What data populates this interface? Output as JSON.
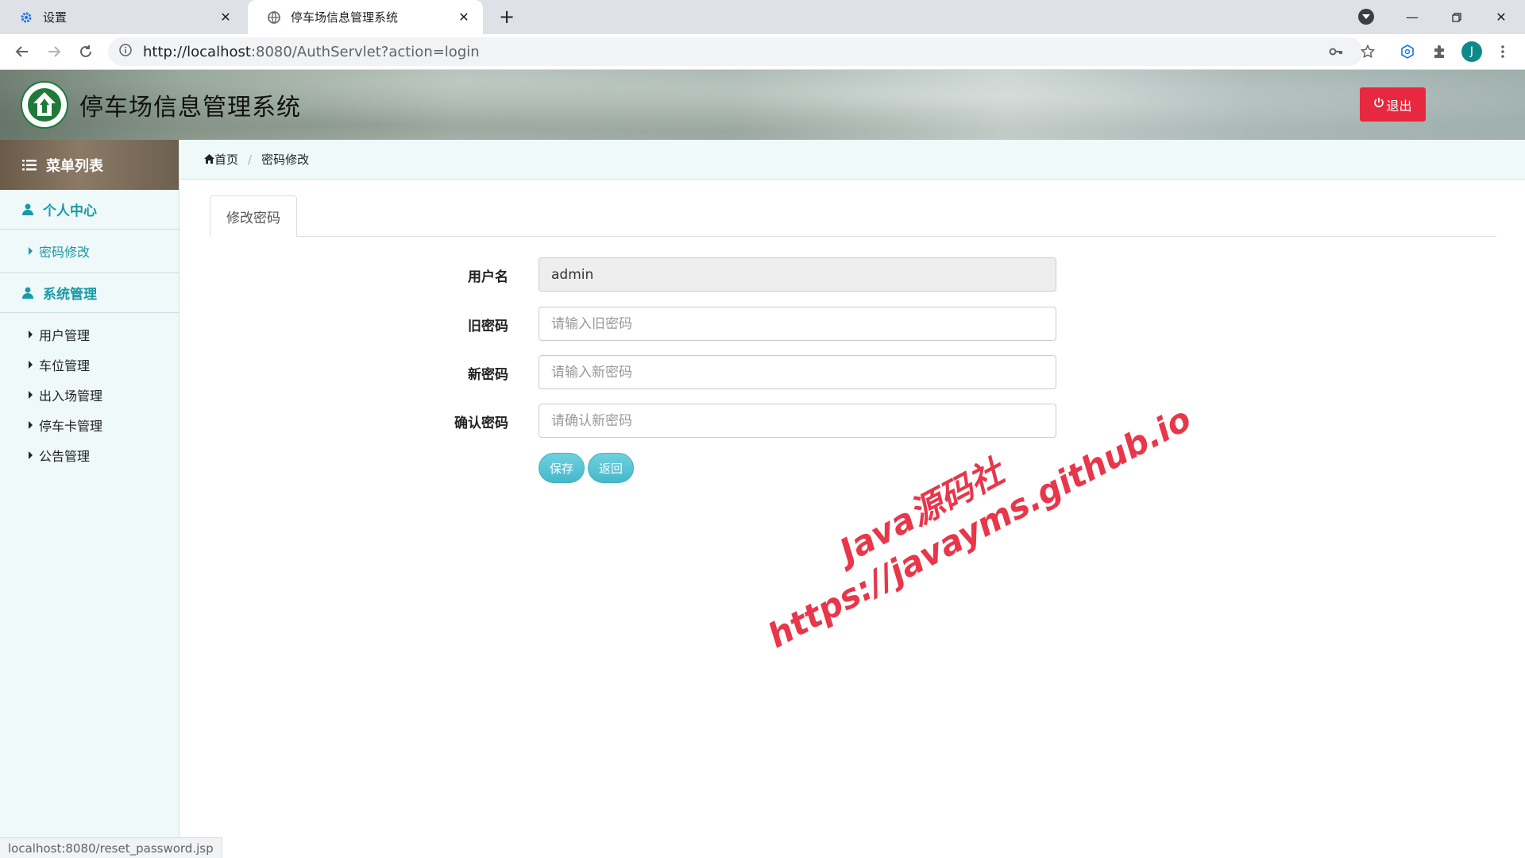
{
  "browser": {
    "tabs": [
      {
        "title": "设置",
        "icon": "gear-icon"
      },
      {
        "title": "停车场信息管理系统",
        "icon": "globe-icon"
      }
    ],
    "url_host": "http://localhost",
    "url_rest": ":8080/AuthServlet?action=login",
    "avatar_letter": "J",
    "status_url": "localhost:8080/reset_password.jsp"
  },
  "header": {
    "title": "停车场信息管理系统",
    "logout_label": "退出"
  },
  "sidebar": {
    "menu_title": "菜单列表",
    "groups": [
      {
        "title": "个人中心",
        "items": [
          {
            "label": "密码修改",
            "active": true
          }
        ]
      },
      {
        "title": "系统管理",
        "items": [
          {
            "label": "用户管理"
          },
          {
            "label": "车位管理"
          },
          {
            "label": "出入场管理"
          },
          {
            "label": "停车卡管理"
          },
          {
            "label": "公告管理"
          }
        ]
      }
    ]
  },
  "breadcrumb": {
    "home": "首页",
    "current": "密码修改"
  },
  "content": {
    "tab_label": "修改密码",
    "form": {
      "username_label": "用户名",
      "username_value": "admin",
      "old_password_label": "旧密码",
      "old_password_placeholder": "请输入旧密码",
      "new_password_label": "新密码",
      "new_password_placeholder": "请输入新密码",
      "confirm_password_label": "确认密码",
      "confirm_password_placeholder": "请确认新密码",
      "save_label": "保存",
      "back_label": "返回"
    }
  },
  "watermark": {
    "line1": "Java源码社",
    "line2": "https://javayms.github.io"
  },
  "colors": {
    "accent": "#1a9aa8",
    "logout": "#e8283f",
    "button": "#5bc0de",
    "watermark": "#e8364a"
  }
}
